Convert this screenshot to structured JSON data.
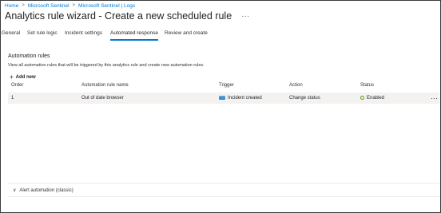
{
  "breadcrumb": [
    "Home",
    "Microsoft Sentinel",
    "Microsoft Sentinel | Logs"
  ],
  "header": {
    "title": "Analytics rule wizard - Create a new scheduled rule",
    "more_icon": "ellipsis-icon"
  },
  "tabs": [
    {
      "label": "General",
      "active": false
    },
    {
      "label": "Set rule logic",
      "active": false
    },
    {
      "label": "Incident settings",
      "active": false
    },
    {
      "label": "Automated response",
      "active": true
    },
    {
      "label": "Review and create",
      "active": false
    }
  ],
  "automation": {
    "title": "Automation rules",
    "description": "View all automation rules that will be triggered by this analytics rule and create new automation rules.",
    "add_new_label": "Add new",
    "columns": [
      "Order",
      "Automation rule name",
      "Trigger",
      "Action",
      "Status"
    ],
    "rows": [
      {
        "order": "1",
        "name": "Out of date browser",
        "trigger": "Incident created",
        "action": "Change status",
        "status": "Enabled"
      }
    ]
  },
  "alert_automation": {
    "label": "Alert automation (classic)"
  },
  "colors": {
    "accent": "#0078d4",
    "enabled": "#57a300",
    "row_bg": "#f3f2f1"
  }
}
